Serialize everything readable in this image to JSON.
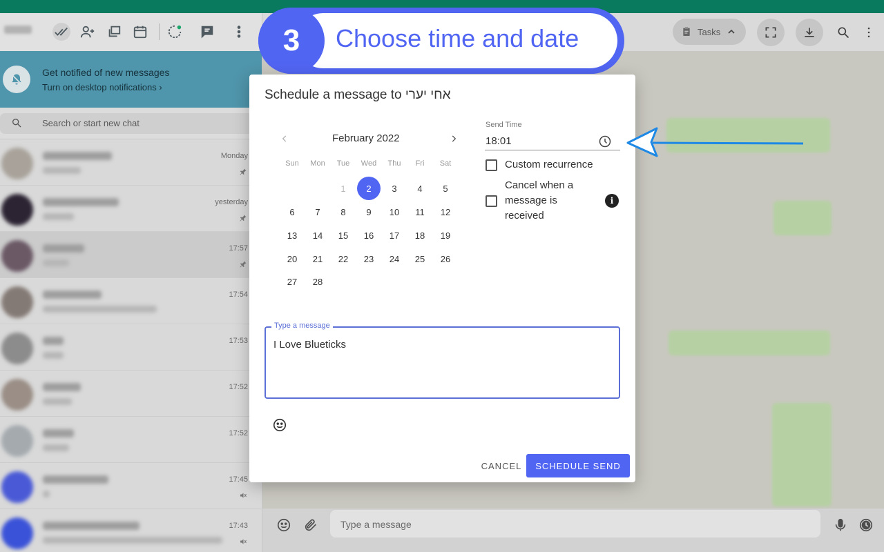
{
  "sidebar": {
    "notification": {
      "title": "Get notified of new messages",
      "subtitle": "Turn on desktop notifications ›"
    },
    "search_placeholder": "Search or start new chat",
    "chats": [
      {
        "time": "Monday",
        "pinned": true
      },
      {
        "time": "yesterday",
        "pinned": true
      },
      {
        "time": "17:57",
        "pinned": true
      },
      {
        "time": "17:54",
        "pinned": false
      },
      {
        "time": "17:53",
        "pinned": false
      },
      {
        "time": "17:52",
        "pinned": false
      },
      {
        "time": "17:52",
        "pinned": false
      },
      {
        "time": "17:45",
        "pinned": false
      },
      {
        "time": "17:43",
        "pinned": false
      }
    ]
  },
  "header": {
    "tasks_label": "Tasks"
  },
  "composer": {
    "placeholder": "Type a message"
  },
  "banner": {
    "step_number": "3",
    "text": "Choose time and date"
  },
  "dialog": {
    "title": "Schedule a message to אחי יערי",
    "calendar": {
      "month_label": "February 2022",
      "weekdays": [
        "Sun",
        "Mon",
        "Tue",
        "Wed",
        "Thu",
        "Fri",
        "Sat"
      ],
      "days": [
        "1",
        "2",
        "3",
        "4",
        "5",
        "6",
        "7",
        "8",
        "9",
        "10",
        "11",
        "12",
        "13",
        "14",
        "15",
        "16",
        "17",
        "18",
        "19",
        "20",
        "21",
        "22",
        "23",
        "24",
        "25",
        "26",
        "27",
        "28"
      ],
      "disabled_days": [
        "1"
      ],
      "selected_day": "2"
    },
    "send_time_label": "Send Time",
    "send_time_value": "18:01",
    "custom_recurrence_label": "Custom recurrence",
    "cancel_when_label_1": "Cancel when a",
    "cancel_when_label_2": "message is",
    "cancel_when_label_3": "received",
    "info_icon_glyph": "i",
    "message_legend": "Type a message",
    "message_value": "I Love Blueticks",
    "cancel_label": "CANCEL",
    "schedule_label": "SCHEDULE SEND"
  },
  "colors": {
    "accent": "#5165f3",
    "whatsapp_green": "#0a7a5e",
    "arrow": "#1e88e5"
  }
}
